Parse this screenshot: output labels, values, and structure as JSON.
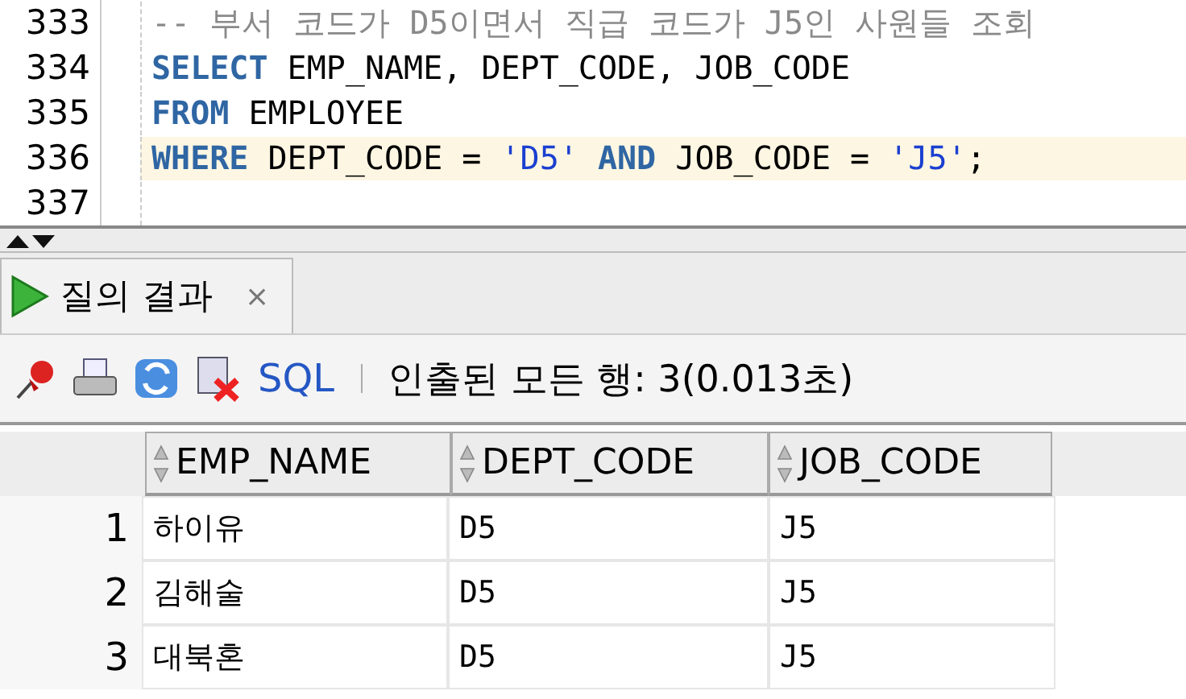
{
  "editor": {
    "lines": [
      {
        "number": "333",
        "current": false,
        "tokens": [
          {
            "kind": "comment",
            "text": "-- 부서 코드가 D5이면서 직급 코드가 J5인 사원들 조회"
          }
        ]
      },
      {
        "number": "334",
        "current": false,
        "tokens": [
          {
            "kind": "keyword",
            "text": "SELECT"
          },
          {
            "kind": "plain",
            "text": " EMP_NAME, DEPT_CODE, JOB_CODE"
          }
        ]
      },
      {
        "number": "335",
        "current": false,
        "tokens": [
          {
            "kind": "keyword",
            "text": "FROM"
          },
          {
            "kind": "plain",
            "text": " EMPLOYEE"
          }
        ]
      },
      {
        "number": "336",
        "current": true,
        "tokens": [
          {
            "kind": "keyword",
            "text": "WHERE"
          },
          {
            "kind": "plain",
            "text": " DEPT_CODE = "
          },
          {
            "kind": "string",
            "text": "'D5'"
          },
          {
            "kind": "keyword",
            "text": " AND"
          },
          {
            "kind": "plain",
            "text": " JOB_CODE = "
          },
          {
            "kind": "string",
            "text": "'J5'"
          },
          {
            "kind": "plain",
            "text": ";"
          }
        ]
      },
      {
        "number": "337",
        "current": false
      }
    ]
  },
  "tabs": [
    {
      "label": "질의 결과",
      "close": "×",
      "selected": true
    }
  ],
  "toolbar": {
    "sql_link": "SQL",
    "status": "인출된 모든 행: 3(0.013초)"
  },
  "table": {
    "columns": [
      "EMP_NAME",
      "DEPT_CODE",
      "JOB_CODE"
    ],
    "rows": [
      {
        "number": "1",
        "cells": [
          "하이유",
          "D5",
          "J5"
        ]
      },
      {
        "number": "2",
        "cells": [
          "김해술",
          "D5",
          "J5"
        ]
      },
      {
        "number": "3",
        "cells": [
          "대북혼",
          "D5",
          "J5"
        ]
      }
    ]
  }
}
